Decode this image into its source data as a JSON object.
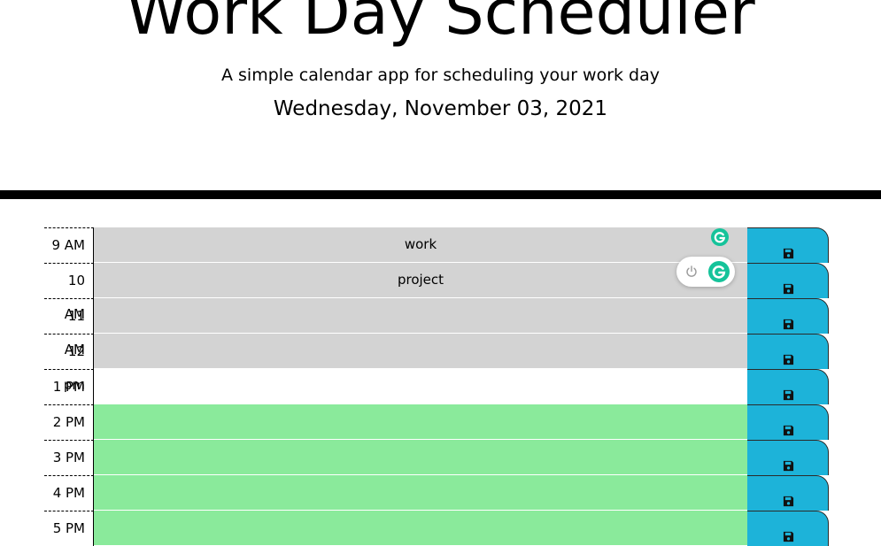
{
  "header": {
    "title": "Work Day Scheduler",
    "subtitle": "A simple calendar app for scheduling your work day",
    "current_date": "Wednesday, November 03, 2021"
  },
  "colors": {
    "past": "#d3d3d3",
    "present": "#ffffff",
    "future": "#8aea9b",
    "save_button": "#1db3d9",
    "grammarly": "#15c39a"
  },
  "time_blocks": [
    {
      "hour": "9 AM",
      "text": "work",
      "state": "past"
    },
    {
      "hour": "10 AM",
      "text": "project",
      "state": "past"
    },
    {
      "hour": "11 AM",
      "text": "",
      "state": "past"
    },
    {
      "hour": "12 pm",
      "text": "",
      "state": "past"
    },
    {
      "hour": "1 PM",
      "text": "",
      "state": "present"
    },
    {
      "hour": "2 PM",
      "text": "",
      "state": "future"
    },
    {
      "hour": "3 PM",
      "text": "",
      "state": "future"
    },
    {
      "hour": "4 PM",
      "text": "",
      "state": "future"
    },
    {
      "hour": "5 PM",
      "text": "",
      "state": "future"
    }
  ],
  "icons": {
    "save": "floppy-disk-icon",
    "grammarly": "grammarly-icon",
    "power": "power-icon"
  }
}
